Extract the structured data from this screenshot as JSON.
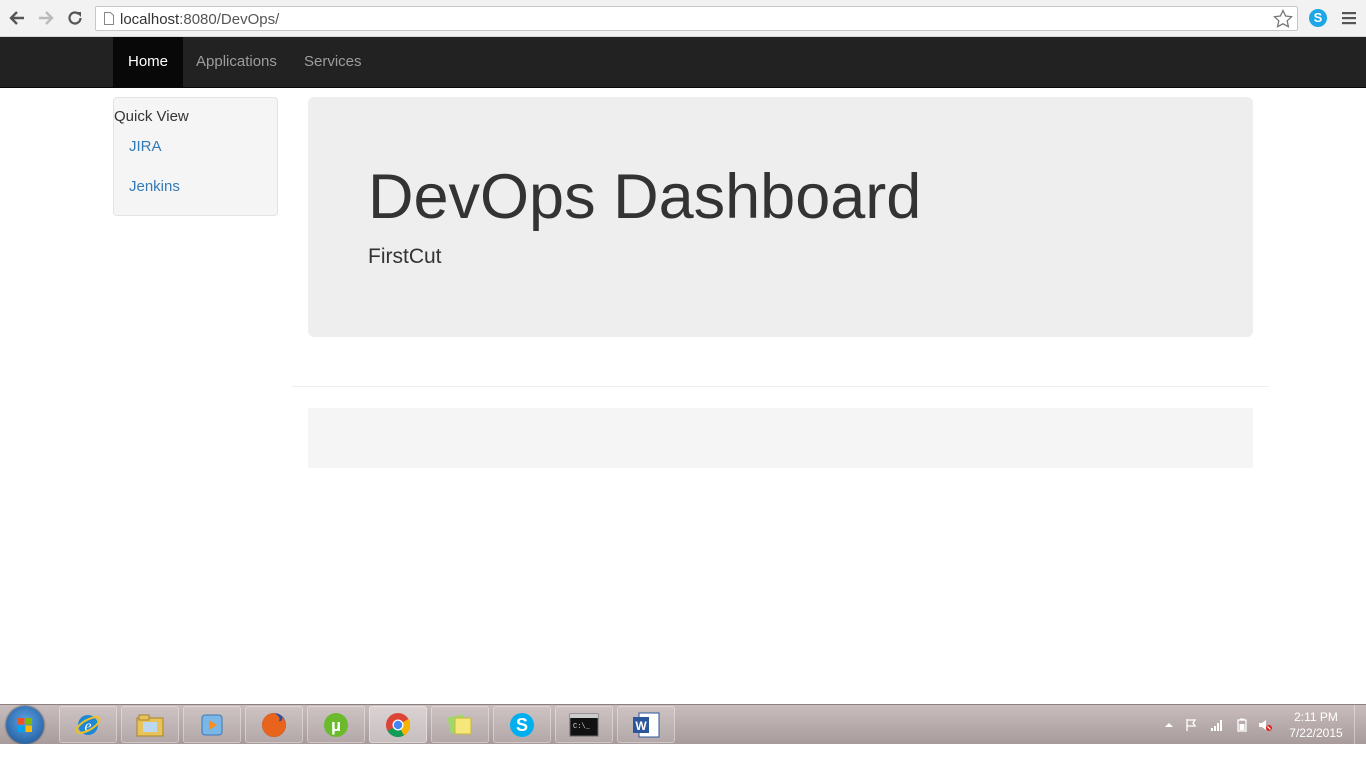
{
  "browser": {
    "url_host": "localhost",
    "url_rest": ":8080/DevOps/"
  },
  "navbar": {
    "items": [
      {
        "label": "Home",
        "active": true
      },
      {
        "label": "Applications",
        "active": false
      },
      {
        "label": "Services",
        "active": false
      }
    ]
  },
  "sidebar": {
    "title": "Quick View",
    "links": [
      {
        "label": "JIRA"
      },
      {
        "label": "Jenkins"
      }
    ]
  },
  "jumbotron": {
    "title": "DevOps Dashboard",
    "subtitle": "FirstCut"
  },
  "taskbar": {
    "apps": [
      {
        "name": "internet-explorer-icon",
        "active": false
      },
      {
        "name": "file-explorer-icon",
        "active": false
      },
      {
        "name": "media-player-icon",
        "active": false
      },
      {
        "name": "firefox-icon",
        "active": false
      },
      {
        "name": "utorrent-icon",
        "active": false
      },
      {
        "name": "chrome-icon",
        "active": true
      },
      {
        "name": "sticky-notes-icon",
        "active": false
      },
      {
        "name": "skype-icon",
        "active": false
      },
      {
        "name": "command-prompt-icon",
        "active": false
      },
      {
        "name": "word-icon",
        "active": false
      }
    ],
    "clock_time": "2:11 PM",
    "clock_date": "7/22/2015"
  },
  "colors": {
    "navbar_bg": "#222222",
    "link": "#337ab7",
    "jumbotron_bg": "#eeeeee"
  }
}
